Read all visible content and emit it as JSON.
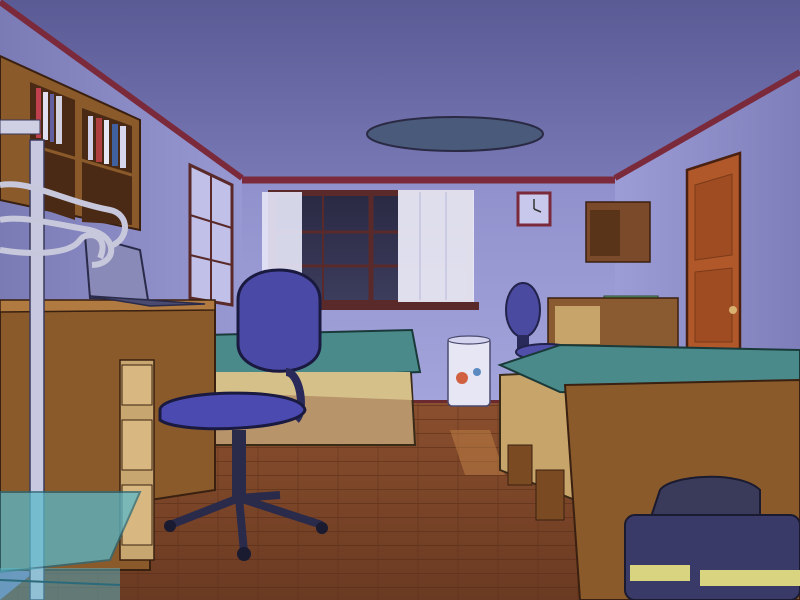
{
  "scene": {
    "type": "visual-novel-background",
    "setting": "bedroom-night",
    "objects": [
      "ceiling-light",
      "window",
      "curtains",
      "wall-clock",
      "door",
      "bookshelf",
      "desk",
      "laptop",
      "desk-lamp",
      "office-chair",
      "bed-left",
      "bed-right",
      "far-chair",
      "far-desk",
      "far-shelf",
      "trash-bin",
      "wooden-floor",
      "glass-table",
      "bag",
      "coat-rack"
    ]
  },
  "palette": {
    "ceiling": "#6b6ba6",
    "wall": "#8e8ec8",
    "wall_shadow": "#7777b3",
    "trim": "#7a2a3a",
    "floor": "#8a4a2a",
    "wood": "#7a4a2a",
    "wood_light": "#9a6a3a",
    "door": "#b85a2a",
    "chair": "#4a4aa0",
    "bedsheet": "#4a8a8a",
    "curtain": "#e8e8f8",
    "glass": "#5ab8c8"
  }
}
